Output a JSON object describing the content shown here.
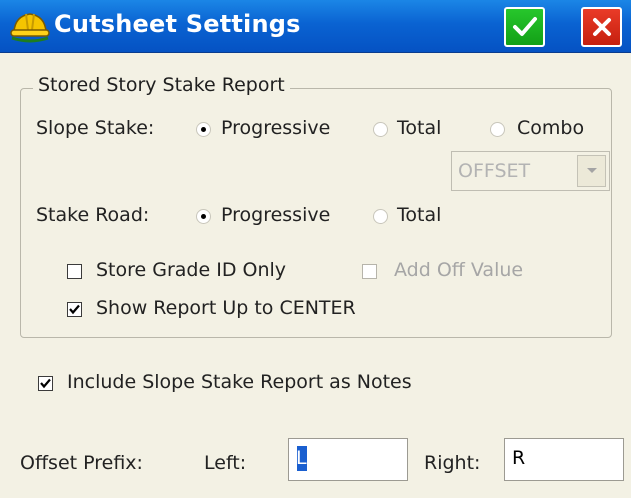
{
  "window": {
    "title": "Cutsheet Settings",
    "ok_icon": "checkmark-icon",
    "close_icon": "close-x-icon",
    "colors": {
      "titlebar": "#0a63d2",
      "ok": "#1fb524",
      "close": "#d9261a"
    }
  },
  "group": {
    "title": "Stored Story Stake Report",
    "slope_stake": {
      "label": "Slope Stake:",
      "options": [
        "Progressive",
        "Total",
        "Combo"
      ],
      "selected": "Progressive"
    },
    "combo": {
      "value": "OFFSET",
      "enabled": false
    },
    "stake_road": {
      "label": "Stake Road:",
      "options": [
        "Progressive",
        "Total"
      ],
      "selected": "Progressive"
    },
    "store_grade_id": {
      "label": "Store Grade ID Only",
      "checked": false
    },
    "add_off_value": {
      "label": "Add Off Value",
      "checked": false,
      "enabled": false
    },
    "show_report": {
      "label": "Show Report Up to CENTER",
      "checked": true
    }
  },
  "include_notes": {
    "label": "Include Slope Stake Report as Notes",
    "checked": true
  },
  "offset_prefix": {
    "label": "Offset Prefix:",
    "left_label": "Left:",
    "left_value": "L",
    "right_label": "Right:",
    "right_value": "R"
  }
}
